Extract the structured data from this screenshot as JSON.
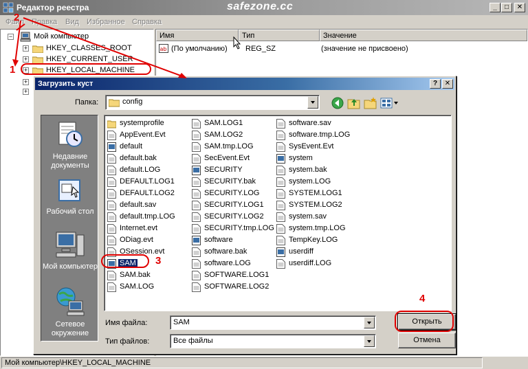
{
  "window": {
    "title": "Редактор реестра",
    "watermark": "safezone.cc"
  },
  "menu": [
    "Файл",
    "Правка",
    "Вид",
    "Избранное",
    "Справка"
  ],
  "tree": {
    "root": "Мой компьютер",
    "items": [
      "HKEY_CLASSES_ROOT",
      "HKEY_CURRENT_USER",
      "HKEY_LOCAL_MACHINE"
    ]
  },
  "list": {
    "columns": [
      "Имя",
      "Тип",
      "Значение"
    ],
    "rows": [
      {
        "name": "(По умолчанию)",
        "type": "REG_SZ",
        "value": "(значение не присвоено)"
      }
    ]
  },
  "statusbar": "Мой компьютер\\HKEY_LOCAL_MACHINE",
  "dialog": {
    "title": "Загрузить куст",
    "look_in_label": "Папка:",
    "look_in_value": "config",
    "places": [
      "Недавние документы",
      "Рабочий стол",
      "Мой компьютер",
      "Сетевое окружение"
    ],
    "files_col1": [
      "systemprofile",
      "AppEvent.Evt",
      "default",
      "default.bak",
      "default.LOG",
      "DEFAULT.LOG1",
      "DEFAULT.LOG2",
      "default.sav",
      "default.tmp.LOG",
      "Internet.evt",
      "ODiag.evt",
      "OSession.evt",
      "SAM",
      "SAM.bak",
      "SAM.LOG"
    ],
    "files_col2": [
      "SAM.LOG1",
      "SAM.LOG2",
      "SAM.tmp.LOG",
      "SecEvent.Evt",
      "SECURITY",
      "SECURITY.bak",
      "SECURITY.LOG",
      "SECURITY.LOG1",
      "SECURITY.LOG2",
      "SECURITY.tmp.LOG",
      "software",
      "software.bak",
      "software.LOG",
      "SOFTWARE.LOG1",
      "SOFTWARE.LOG2"
    ],
    "files_col3": [
      "software.sav",
      "software.tmp.LOG",
      "SysEvent.Evt",
      "system",
      "system.bak",
      "system.LOG",
      "SYSTEM.LOG1",
      "SYSTEM.LOG2",
      "system.sav",
      "system.tmp.LOG",
      "TempKey.LOG",
      "userdiff",
      "userdiff.LOG"
    ],
    "selected_file": "SAM",
    "filename_label": "Имя файла:",
    "filename_value": "SAM",
    "filetype_label": "Тип файлов:",
    "filetype_value": "Все файлы",
    "open_button": "Открыть",
    "cancel_button": "Отмена"
  },
  "annotations": [
    "1",
    "2",
    "3",
    "4"
  ],
  "colors": {
    "annotation": "#e00000",
    "selection": "#0a246a"
  }
}
